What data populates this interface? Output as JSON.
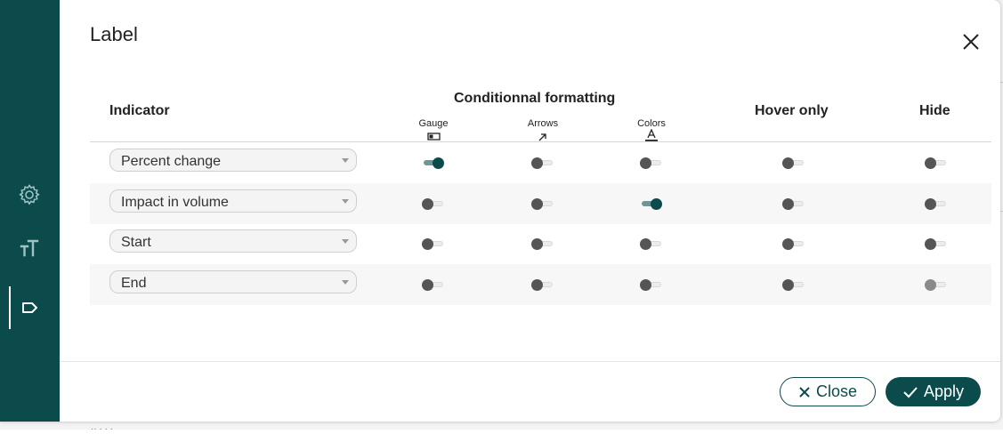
{
  "dialog": {
    "title": "Label"
  },
  "sidebar": {
    "items": [
      {
        "icon": "gear-icon"
      },
      {
        "icon": "text-size-icon"
      },
      {
        "icon": "label-tag-icon",
        "active": true
      }
    ]
  },
  "table": {
    "headers": {
      "indicator": "Indicator",
      "conditional": "Conditionnal formatting",
      "gauge": "Gauge",
      "arrows": "Arrows",
      "colors": "Colors",
      "hover": "Hover only",
      "hide": "Hide"
    },
    "rows": [
      {
        "indicator": "Percent change",
        "gauge": true,
        "arrows": false,
        "colors": false,
        "hover": false,
        "hide": false
      },
      {
        "indicator": "Impact in volume",
        "gauge": false,
        "arrows": false,
        "colors": true,
        "hover": false,
        "hide": false
      },
      {
        "indicator": "Start",
        "gauge": false,
        "arrows": false,
        "colors": false,
        "hover": false,
        "hide": false
      },
      {
        "indicator": "End",
        "gauge": false,
        "arrows": false,
        "colors": false,
        "hover": false,
        "hide": false,
        "hide_disabled": true
      }
    ]
  },
  "footer": {
    "close_label": "Close",
    "apply_label": "Apply"
  },
  "colors": {
    "brand": "#0c4b4b",
    "toggle_on_track": "#6f9696",
    "toggle_off_knob": "#555555"
  }
}
